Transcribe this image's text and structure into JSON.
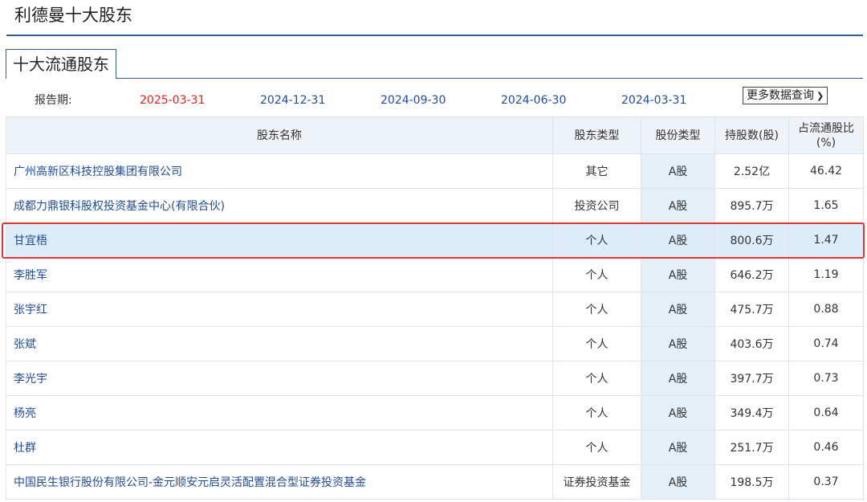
{
  "page": {
    "title": "利德曼十大股东"
  },
  "section": {
    "tab_label": "十大流通股东"
  },
  "periods": {
    "label": "报告期:",
    "dates": [
      "2025-03-31",
      "2024-12-31",
      "2024-09-30",
      "2024-06-30",
      "2024-03-31"
    ],
    "selected": "2025-03-31"
  },
  "more_query": {
    "label": "更多数据查询",
    "icon": "chevron-down-icon"
  },
  "colors": {
    "accent": "#36598f",
    "link": "#1f4c96",
    "selected_period": "#e02020",
    "highlight_border": "#e53330"
  },
  "table": {
    "headers": {
      "name": "股东名称",
      "holder_type": "股东类型",
      "share_type": "股份类型",
      "shares": "持股数(股)",
      "ratio": "占流通股比(%)"
    },
    "highlighted_row": 2,
    "rows": [
      {
        "name": "广州高新区科技控股集团有限公司",
        "holder_type": "其它",
        "share_type": "A股",
        "shares": "2.52亿",
        "ratio": "46.42"
      },
      {
        "name": "成都力鼎银科股权投资基金中心(有限合伙)",
        "holder_type": "投资公司",
        "share_type": "A股",
        "shares": "895.7万",
        "ratio": "1.65"
      },
      {
        "name": "甘宜梧",
        "holder_type": "个人",
        "share_type": "A股",
        "shares": "800.6万",
        "ratio": "1.47"
      },
      {
        "name": "李胜军",
        "holder_type": "个人",
        "share_type": "A股",
        "shares": "646.2万",
        "ratio": "1.19"
      },
      {
        "name": "张宇红",
        "holder_type": "个人",
        "share_type": "A股",
        "shares": "475.7万",
        "ratio": "0.88"
      },
      {
        "name": "张斌",
        "holder_type": "个人",
        "share_type": "A股",
        "shares": "403.6万",
        "ratio": "0.74"
      },
      {
        "name": "李光宇",
        "holder_type": "个人",
        "share_type": "A股",
        "shares": "397.7万",
        "ratio": "0.73"
      },
      {
        "name": "杨亮",
        "holder_type": "个人",
        "share_type": "A股",
        "shares": "349.4万",
        "ratio": "0.64"
      },
      {
        "name": "杜群",
        "holder_type": "个人",
        "share_type": "A股",
        "shares": "251.7万",
        "ratio": "0.46"
      },
      {
        "name": "中国民生银行股份有限公司-金元顺安元启灵活配置混合型证券投资基金",
        "holder_type": "证券投资基金",
        "share_type": "A股",
        "shares": "198.5万",
        "ratio": "0.37"
      }
    ]
  }
}
